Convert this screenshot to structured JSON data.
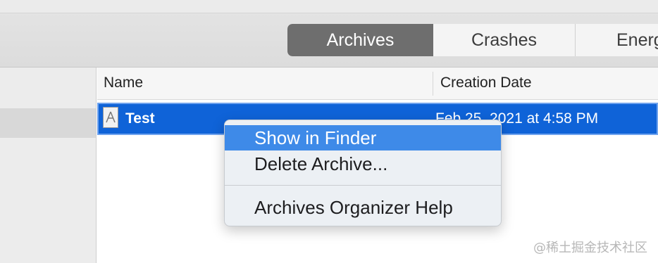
{
  "toolbar": {
    "tabs": [
      {
        "label": "Archives",
        "active": true
      },
      {
        "label": "Crashes",
        "active": false
      },
      {
        "label": "Energ",
        "active": false
      }
    ]
  },
  "table": {
    "columns": [
      "Name",
      "Creation Date"
    ],
    "rows": [
      {
        "name": "Test",
        "date": "Feb 25, 2021 at 4:58 PM",
        "selected": true,
        "icon": "archive-document-icon"
      }
    ]
  },
  "context_menu": {
    "items": [
      {
        "label": "Show in Finder",
        "highlighted": true
      },
      {
        "label": "Delete Archive...",
        "highlighted": false
      },
      {
        "label": "Archives Organizer Help",
        "highlighted": false
      }
    ]
  },
  "colors": {
    "selection": "#0f63d8",
    "menu_highlight": "#3e8ae8",
    "active_tab": "#6e6e6e"
  },
  "watermark": "@稀土掘金技术社区"
}
